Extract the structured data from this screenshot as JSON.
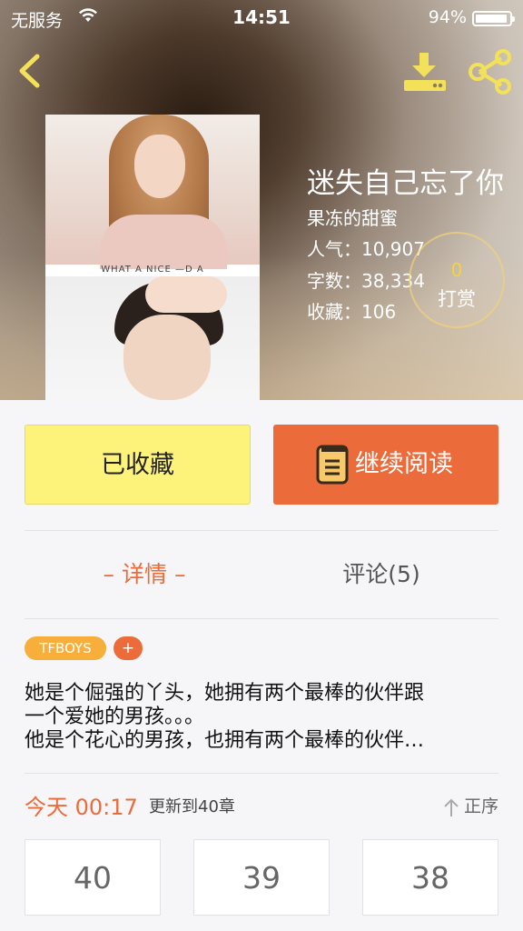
{
  "status_bar": {
    "carrier": "无服务",
    "time": "14:51",
    "battery": "94%",
    "battery_level": 0.94
  },
  "icons": {
    "back": "chevron-left-icon",
    "download": "download-icon",
    "share": "share-icon",
    "book": "book-icon",
    "sort": "arrow-up-icon"
  },
  "cover": {
    "caption": "WHAT A NICE —D A"
  },
  "book": {
    "title": "迷失自己忘了你",
    "author": "果冻的甜蜜",
    "popularity": "人气：10,907",
    "word_count": "字数：38,334",
    "favorites": "收藏：106"
  },
  "tip": {
    "count": "0",
    "label": "打赏"
  },
  "actions": {
    "collected": "已收藏",
    "continue_reading": "继续阅读"
  },
  "tabs": {
    "details": "– 详情 –",
    "comments": "评论(5)"
  },
  "tags": {
    "items": [
      "TFBOYS"
    ],
    "add": "+"
  },
  "synopsis": {
    "lines": [
      "她是个倔强的丫头，她拥有两个最棒的伙伴跟",
      "一个爱她的男孩。。。",
      "他是个花心的男孩，也拥有两个最棒的伙伴…"
    ]
  },
  "update": {
    "time": "今天 00:17",
    "info": "更新到40章",
    "sort": "正序"
  },
  "chapters": [
    "40",
    "39",
    "38"
  ],
  "colors": {
    "accent": "#ec6b3a",
    "collected_bg": "#fdf27a",
    "tag_bg": "#f7ae3a",
    "icon_yellow": "#f3e15a"
  }
}
